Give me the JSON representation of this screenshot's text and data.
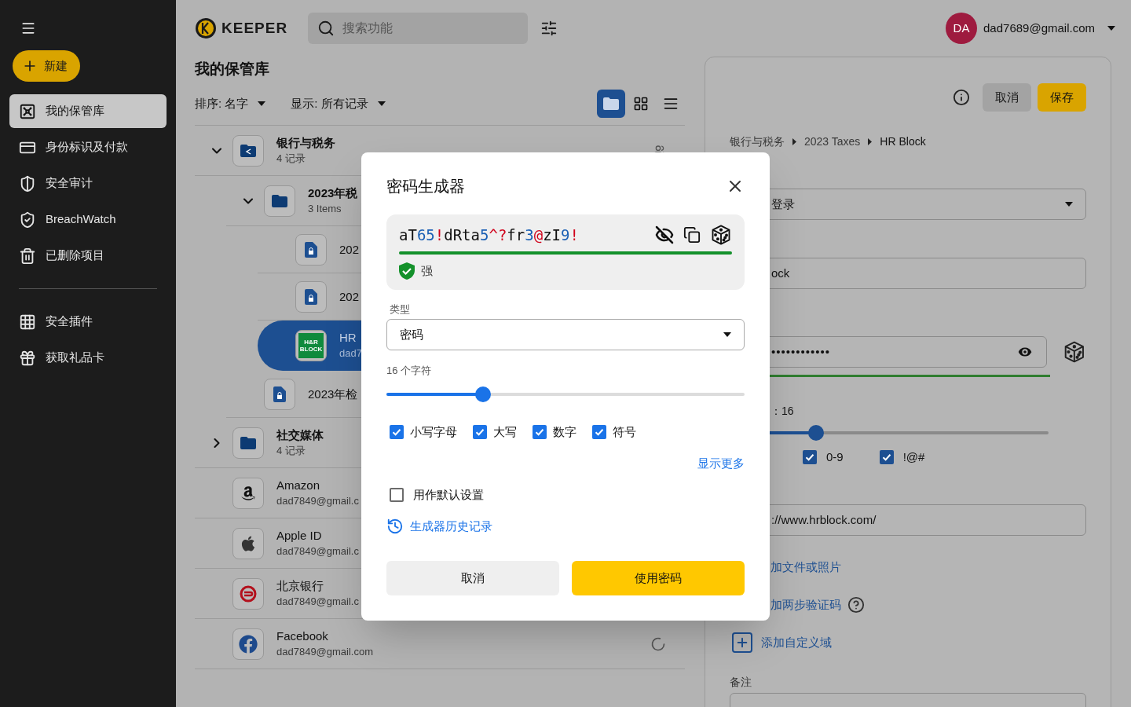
{
  "sidebar": {
    "new_button": "新建",
    "items": [
      {
        "label": "我的保管库",
        "selected": true
      },
      {
        "label": "身份标识及付款",
        "selected": false
      },
      {
        "label": "安全审计",
        "selected": false
      },
      {
        "label": "BreachWatch",
        "selected": false
      },
      {
        "label": "已删除项目",
        "selected": false
      }
    ],
    "extras": [
      {
        "label": "安全插件"
      },
      {
        "label": "获取礼品卡"
      }
    ]
  },
  "topbar": {
    "logo": "KEEPER",
    "search": {
      "placeholder": "搜索功能"
    },
    "account": {
      "initials": "DA",
      "email": "dad7689@gmail.com"
    }
  },
  "vault": {
    "title": "我的保管库",
    "sort": "排序: 名字",
    "filter": "显示: 所有记录",
    "views": [
      {
        "selected": true
      },
      {
        "selected": false
      },
      {
        "selected": false
      }
    ],
    "rows": [
      {
        "kind": "shared_folder",
        "title": "银行与税务",
        "subtitle": "4 记录",
        "expanded": true,
        "selected": false,
        "children": [
          {
            "kind": "folder",
            "title": "2023年税",
            "subtitle": "3 Items",
            "expanded": true,
            "selected": false,
            "children": [
              {
                "kind": "document",
                "title": "202",
                "selected": false
              },
              {
                "kind": "document",
                "title": "202",
                "selected": false
              },
              {
                "kind": "hrblock",
                "logo_text": "H&R BLOCK",
                "title": "HR",
                "subtitle": "dad7",
                "selected": true
              }
            ]
          },
          {
            "kind": "document",
            "title": "2023年检",
            "selected": false
          }
        ]
      },
      {
        "kind": "folder",
        "title": "社交媒体",
        "subtitle": "4 记录",
        "expanded": false,
        "selected": false
      },
      {
        "kind": "amazon",
        "title": "Amazon",
        "subtitle": "dad7849@gmail.c",
        "selected": false
      },
      {
        "kind": "apple",
        "title": "Apple ID",
        "subtitle": "dad7849@gmail.c",
        "selected": false
      },
      {
        "kind": "bank",
        "title": "北京银行",
        "subtitle": "dad7849@gmail.c",
        "selected": false
      },
      {
        "kind": "facebook",
        "title": "Facebook",
        "subtitle": "dad7849@gmail.com",
        "selected": false,
        "syncing": true
      }
    ]
  },
  "record_panel": {
    "cancel": "取消",
    "save": "保存",
    "breadcrumb": [
      "银行与税务",
      "2023 Taxes",
      "HR Block"
    ],
    "type_value": "登录",
    "title_value": "ock",
    "password_dots": "••••••••••••",
    "length_label": "：16",
    "length_slider": {
      "level": 0.27
    },
    "options": [
      {
        "label": "0-9",
        "checked": true
      },
      {
        "label": "!@#",
        "checked": true
      }
    ],
    "url": "://www.hrblock.com/",
    "links": [
      {
        "label": "加文件或照片",
        "kind": "text"
      },
      {
        "label": "加两步验证码",
        "kind": "help"
      },
      {
        "label": "添加自定义域",
        "kind": "add"
      }
    ],
    "notes_label": "备注"
  },
  "dialog": {
    "title": "密码生成器",
    "password": [
      {
        "text": "aT",
        "kind": "letter"
      },
      {
        "text": "65",
        "kind": "digit"
      },
      {
        "text": "!",
        "kind": "symbol"
      },
      {
        "text": "dRta",
        "kind": "letter"
      },
      {
        "text": "5",
        "kind": "digit"
      },
      {
        "text": "^?",
        "kind": "symbol"
      },
      {
        "text": "fr",
        "kind": "letter"
      },
      {
        "text": "3",
        "kind": "digit"
      },
      {
        "text": "@",
        "kind": "symbol"
      },
      {
        "text": "zI",
        "kind": "letter"
      },
      {
        "text": "9",
        "kind": "digit"
      },
      {
        "text": "!",
        "kind": "symbol"
      }
    ],
    "strength": "强",
    "type_label": "类型",
    "type_value": "密码",
    "length_label": "16 个字符",
    "length_slider": {
      "level": 0.27
    },
    "options": [
      {
        "label": "小写字母",
        "checked": true
      },
      {
        "label": "大写",
        "checked": true
      },
      {
        "label": "数字",
        "checked": true
      },
      {
        "label": "符号",
        "checked": true
      }
    ],
    "show_more": "显示更多",
    "default_option": {
      "label": "用作默认设置",
      "checked": false
    },
    "history_link": "生成器历史记录",
    "cancel": "取消",
    "confirm": "使用密码"
  }
}
